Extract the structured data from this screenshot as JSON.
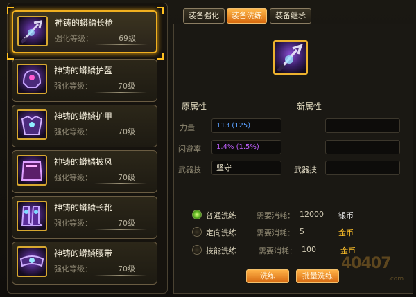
{
  "items": [
    {
      "name": "神铸的蟒鳞长枪",
      "level_label": "强化等级：",
      "level": "69级",
      "icon": "spear-icon"
    },
    {
      "name": "神铸的蟒鳞护盔",
      "level_label": "强化等级：",
      "level": "70级",
      "icon": "helmet-icon"
    },
    {
      "name": "神铸的蟒鳞护甲",
      "level_label": "强化等级：",
      "level": "70级",
      "icon": "armor-icon"
    },
    {
      "name": "神铸的蟒鳞披风",
      "level_label": "强化等级：",
      "level": "70级",
      "icon": "cloak-icon"
    },
    {
      "name": "神铸的蟒鳞长靴",
      "level_label": "强化等级：",
      "level": "70级",
      "icon": "boots-icon"
    },
    {
      "name": "神铸的蟒鳞腰带",
      "level_label": "强化等级：",
      "level": "70级",
      "icon": "belt-icon"
    }
  ],
  "tabs": [
    "装备强化",
    "装备洗练",
    "装备继承"
  ],
  "active_tab": 1,
  "attrs": {
    "original_title": "原属性",
    "new_title": "新属性",
    "strength_label": "力量",
    "strength_value": "113 (125)",
    "dodge_label": "闪避率",
    "dodge_value": "1.4% (1.5%)",
    "weapon_skill_label": "武器技",
    "weapon_skill_value": "坚守",
    "new_weapon_skill_label": "武器技"
  },
  "options": [
    {
      "label": "普通洗练",
      "cost_label": "需要消耗：",
      "cost": "12000",
      "currency": "银币",
      "selected": true
    },
    {
      "label": "定向洗练",
      "cost_label": "需要消耗：",
      "cost": "5",
      "currency": "金币",
      "selected": false
    },
    {
      "label": "技能洗练",
      "cost_label": "需要消耗：",
      "cost": "100",
      "currency": "金币",
      "selected": false
    }
  ],
  "buttons": {
    "refine": "洗练",
    "batch_refine": "批量洗练"
  },
  "colors": {
    "accent_gold": "#f0b020",
    "strength_blue": "#5aa0ff",
    "dodge_purple": "#c060ff",
    "silver": "#e6e6e6",
    "gold_coin": "#ffc02a"
  },
  "watermark": {
    "main": "40407",
    "suffix": ".com"
  }
}
